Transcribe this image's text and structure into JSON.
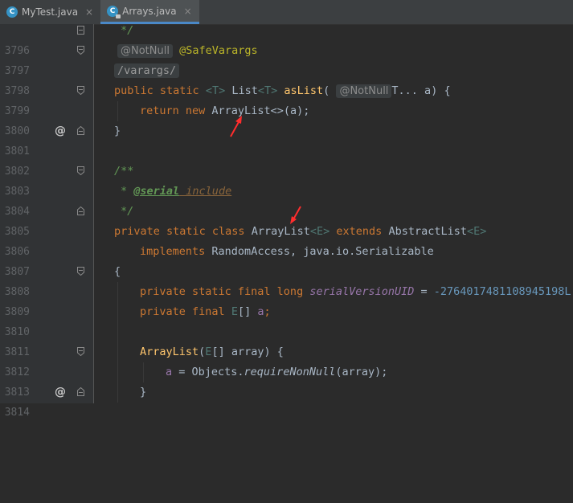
{
  "tabs": [
    {
      "label": "MyTest.java",
      "close": "×",
      "active": false,
      "icon_letter": "C"
    },
    {
      "label": "Arrays.java",
      "close": "×",
      "active": true,
      "icon_letter": "C"
    }
  ],
  "gutter_marks": {
    "override": "@"
  },
  "lines": {
    "l3796": {
      "num": "3796",
      "t": "*/"
    },
    "l3797": {
      "num": "3797",
      "hint": "@NotNull",
      "ann": "@SafeVarargs"
    },
    "l3798": {
      "num": "3798",
      "t": "/varargs/"
    },
    "l3799": {
      "num": "3799",
      "kw1": "public static",
      "gp1": "<T>",
      "type": "List",
      "gp2": "<T>",
      "mth": "asList",
      "p1": "(",
      "hint": "@NotNull",
      "param": "T... a)",
      "brace": " {"
    },
    "l3800": {
      "num": "3800",
      "kw": "return new",
      "cls": "ArrayList<>(a);"
    },
    "l3801": {
      "num": "3801",
      "t": "}"
    },
    "l3802": {
      "num": "3802"
    },
    "l3803": {
      "num": "3803",
      "t": "/**"
    },
    "l3804": {
      "num": "3804",
      "star": "* ",
      "tag": "@serial",
      "rest": " include"
    },
    "l3805": {
      "num": "3805",
      "t": "*/"
    },
    "l3806": {
      "num": "3806",
      "kw1": "private static class",
      "cls": "ArrayList",
      "gp1": "<E>",
      "kw2": "extends",
      "sup": "AbstractList",
      "gp2": "<E>"
    },
    "l3807": {
      "num": "3807",
      "kw": "implements",
      "rest": "RandomAccess, java.io.Serializable"
    },
    "l3808": {
      "num": "3808",
      "t": "{"
    },
    "l3809": {
      "num": "3809",
      "kw": "private static final long",
      "fld": "serialVersionUID",
      "eq": " = ",
      "num_val": "-2764017481108945198L",
      "semi": ";"
    },
    "l3810": {
      "num": "3810",
      "kw": "private final",
      "gp": "E",
      "rest": "[] ",
      "fld": "a",
      "semi": ";"
    },
    "l3811": {
      "num": "3811"
    },
    "l3812": {
      "num": "3812",
      "mth": "ArrayList",
      "p": "(",
      "gp": "E",
      "rest": "[] array) {"
    },
    "l3813": {
      "num": "3813",
      "fld": "a",
      "mid": " = Objects.",
      "smth": "requireNonNull",
      "rest": "(array);"
    },
    "l3814": {
      "num": "3814",
      "t": "}"
    }
  },
  "colors": {
    "background": "#2b2b2b",
    "gutter": "#313335",
    "keyword": "#cc7832",
    "annotation_arrow": "#ff2d2d"
  }
}
